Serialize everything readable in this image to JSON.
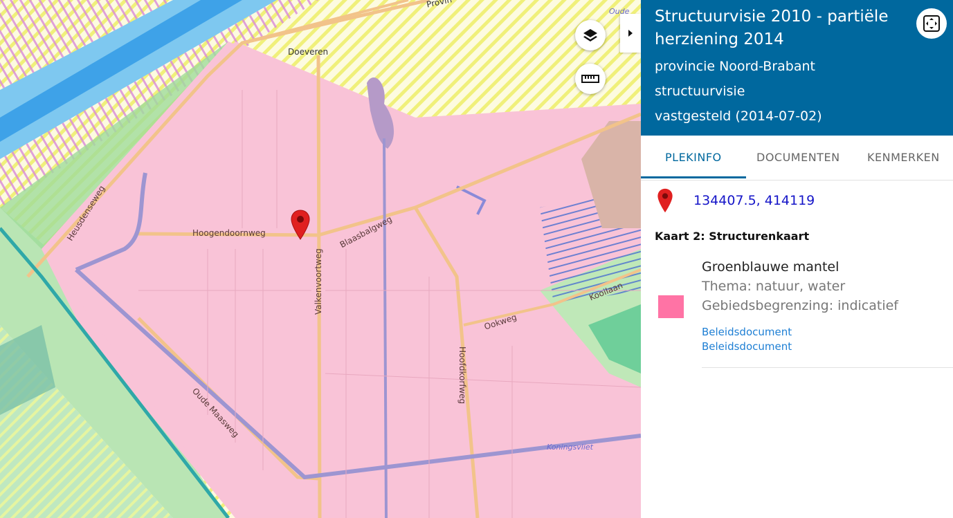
{
  "map": {
    "places": {
      "doeveren": "Doeveren",
      "provin": "Provin",
      "oude": "Oude"
    },
    "streets": {
      "heusdenseweg": "Heusdenseweg",
      "hoogendoornweg": "Hoogendoornweg",
      "valkenvoortweg": "Valkenvoortweg",
      "blaasbalgweg": "Blaasbalgweg",
      "oude_maasweg": "Oude Maasweg",
      "ookweg": "Ookweg",
      "hoofdkorfweg": "Hoofdkorfweg",
      "kooilaan": "Kooilaan"
    },
    "water": {
      "koningsvliet": "Koningsvliet"
    },
    "colors": {
      "zone_pink": "#f9c3d7",
      "marker_red": "#e02020"
    }
  },
  "controls": {
    "layers_icon": "layers-icon",
    "measure_icon": "ruler-icon",
    "collapse_icon": "caret-right-icon"
  },
  "panel": {
    "title": "Structuurvisie 2010 - partiële herziening 2014",
    "subtitle1": "provincie Noord-Brabant",
    "subtitle2": "structuurvisie",
    "subtitle3": "vastgesteld (2014-07-02)",
    "header_color": "#00689e",
    "tabs": [
      {
        "label": "PLEKINFO",
        "active": true
      },
      {
        "label": "DOCUMENTEN",
        "active": false
      },
      {
        "label": "KENMERKEN",
        "active": false
      }
    ],
    "coordinates": "134407.5, 414119",
    "kaart_title": "Kaart 2: Structurenkaart",
    "item": {
      "name": "Groenblauwe mantel",
      "thema": "Thema: natuur, water",
      "begrenzing": "Gebiedsbegrenzing: indicatief",
      "swatch_color": "#ff73a5",
      "links": [
        "Beleidsdocument",
        "Beleidsdocument"
      ]
    }
  }
}
